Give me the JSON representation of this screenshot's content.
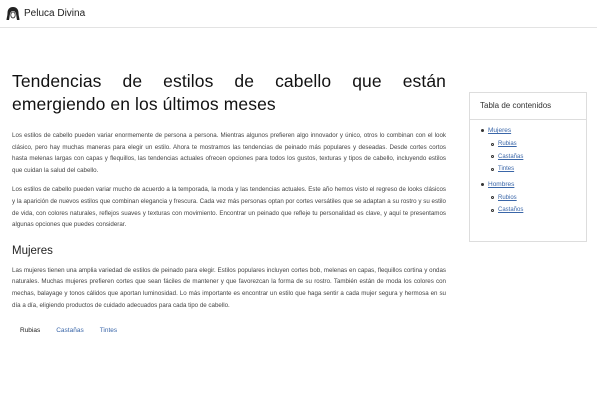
{
  "brand": {
    "name": "Peluca Divina"
  },
  "article": {
    "title": "Tendencias de estilos de cabello que están emergiendo en los últimos meses",
    "paragraphs": [
      "Los estilos de cabello pueden variar enormemente de persona a persona. Mientras algunos prefieren algo innovador y único, otros lo combinan con el look clásico, pero hay muchas maneras para elegir un estilo. Ahora te mostramos las tendencias de peinado más populares y deseadas. Desde cortes cortos hasta melenas largas con capas y flequillos, las tendencias actuales ofrecen opciones para todos los gustos, texturas y tipos de cabello, incluyendo estilos que cuidan la salud del cabello.",
      "Los estilos de cabello pueden variar mucho de acuerdo a la temporada, la moda y las tendencias actuales. Este año hemos visto el regreso de looks clásicos y la aparición de nuevos estilos que combinan elegancia y frescura. Cada vez más personas optan por cortes versátiles que se adaptan a su rostro y su estilo de vida, con colores naturales, reflejos suaves y texturas con movimiento. Encontrar un peinado que refleje tu personalidad es clave, y aquí te presentamos algunas opciones que puedes considerar."
    ],
    "section_heading": "Mujeres",
    "section_paragraph": "Las mujeres tienen una amplia variedad de estilos de peinado para elegir. Estilos populares incluyen cortes bob, melenas en capas, flequillos cortina y ondas naturales. Muchas mujeres prefieren cortes que sean fáciles de mantener y que favorezcan la forma de su rostro. También están de moda los colores con mechas, balayage y tonos cálidos que aportan luminosidad. Lo más importante es encontrar un estilo que haga sentir a cada mujer segura y hermosa en su día a día, eligiendo productos de cuidado adecuados para cada tipo de cabello.",
    "tabs": [
      "Rubias",
      "Castañas",
      "Tintes"
    ]
  },
  "toc": {
    "title": "Tabla de contenidos",
    "items": [
      {
        "label": "Mujeres",
        "children": [
          "Rubias",
          "Castañas",
          "Tintes"
        ]
      },
      {
        "label": "Hombres",
        "children": [
          "Rubios",
          "Castaños"
        ]
      }
    ]
  },
  "colors": {
    "link": "#3a66a8",
    "text": "#222222",
    "border": "#dddddd"
  }
}
